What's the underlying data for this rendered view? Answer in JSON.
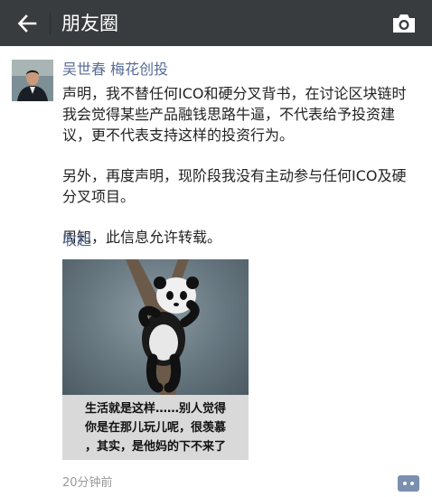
{
  "header": {
    "title": "朋友圈",
    "back_icon": "arrow-left-icon",
    "camera_icon": "camera-icon",
    "background": "#383c3f"
  },
  "post": {
    "author": "吴世春 梅花创投",
    "paragraphs": [
      "声明，我不替任何ICO和硬分叉背书，在讨论区块链时我会觉得某些产品融钱思路牛逼，不代表给予投资建议，更不代表支持这样的投资行为。",
      "另外，再度声明，现阶段我没有主动参与任何ICO及硬分叉项目。",
      "周知，此信息允许转载。"
    ],
    "collapse_label": "收起",
    "image": {
      "caption_lines": [
        "生活就是这样……别人觉得",
        "你是在那儿玩儿呢，很羡慕",
        "，其实，是他妈的下不来了"
      ]
    },
    "time": "20分钟前",
    "comment_icon": "comment-dots-icon",
    "link_color": "#576b95"
  }
}
